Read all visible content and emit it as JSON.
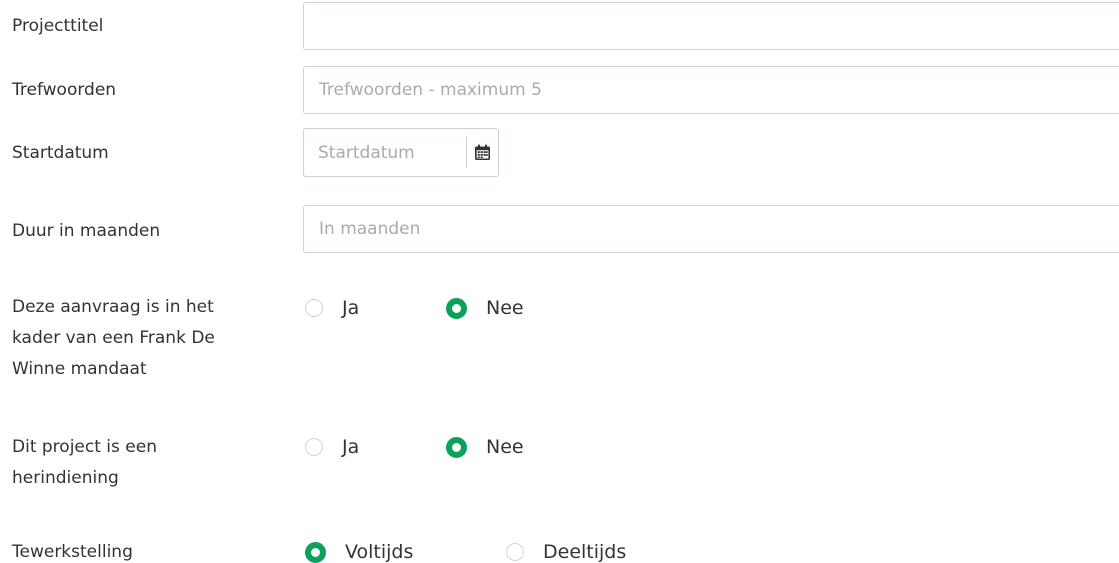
{
  "form": {
    "project_title": {
      "label": "Projecttitel",
      "value": "",
      "placeholder": ""
    },
    "keywords": {
      "label": "Trefwoorden",
      "value": "",
      "placeholder": "Trefwoorden - maximum 5"
    },
    "start_date": {
      "label": "Startdatum",
      "value": "",
      "placeholder": "Startdatum",
      "icon": "calendar-icon"
    },
    "duration": {
      "label": "Duur in maanden",
      "value": "",
      "placeholder": "In maanden"
    },
    "frank_de_winne": {
      "label": "Deze aanvraag is in het kader van een Frank De Winne mandaat",
      "options": [
        {
          "label": "Ja",
          "checked": false
        },
        {
          "label": "Nee",
          "checked": true
        }
      ]
    },
    "resubmission": {
      "label": "Dit project is een herindiening",
      "options": [
        {
          "label": "Ja",
          "checked": false
        },
        {
          "label": "Nee",
          "checked": true
        }
      ]
    },
    "employment": {
      "label": "Tewerkstelling",
      "options": [
        {
          "label": "Voltijds",
          "checked": true
        },
        {
          "label": "Deeltijds",
          "checked": false
        }
      ]
    }
  },
  "colors": {
    "radio_checked": "#0aa25a",
    "input_border": "#cbd2da",
    "placeholder": "#a5acb3",
    "text": "#333332"
  }
}
